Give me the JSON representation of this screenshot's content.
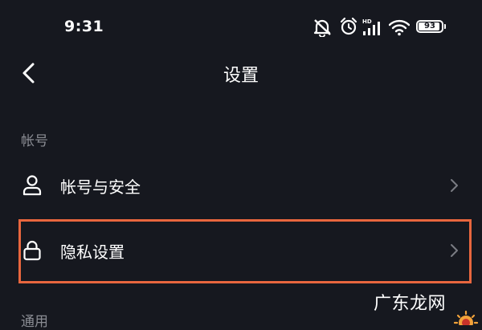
{
  "status_bar": {
    "time": "9:31",
    "network_label": "HD",
    "battery_level": "93",
    "battery_fraction": 0.93,
    "icons": [
      "mute-icon",
      "alarm-icon",
      "cellular-signal-icon",
      "wifi-icon",
      "battery-icon"
    ]
  },
  "header": {
    "back_icon": "chevron-left-icon",
    "title": "设置"
  },
  "sections": [
    {
      "header": "帐号",
      "items": [
        {
          "label": "帐号与安全",
          "icon": "person-icon",
          "highlighted": false
        },
        {
          "label": "隐私设置",
          "icon": "lock-icon",
          "highlighted": true
        }
      ]
    },
    {
      "header": "通用",
      "items": []
    }
  ],
  "annotation": {
    "highlight_color": "#e8663e"
  },
  "watermark": {
    "text": "广东龙网"
  },
  "colors": {
    "background": "#16181f",
    "text_primary": "#ffffff",
    "text_secondary": "#8a8c93",
    "chevron": "#7a7c83"
  }
}
